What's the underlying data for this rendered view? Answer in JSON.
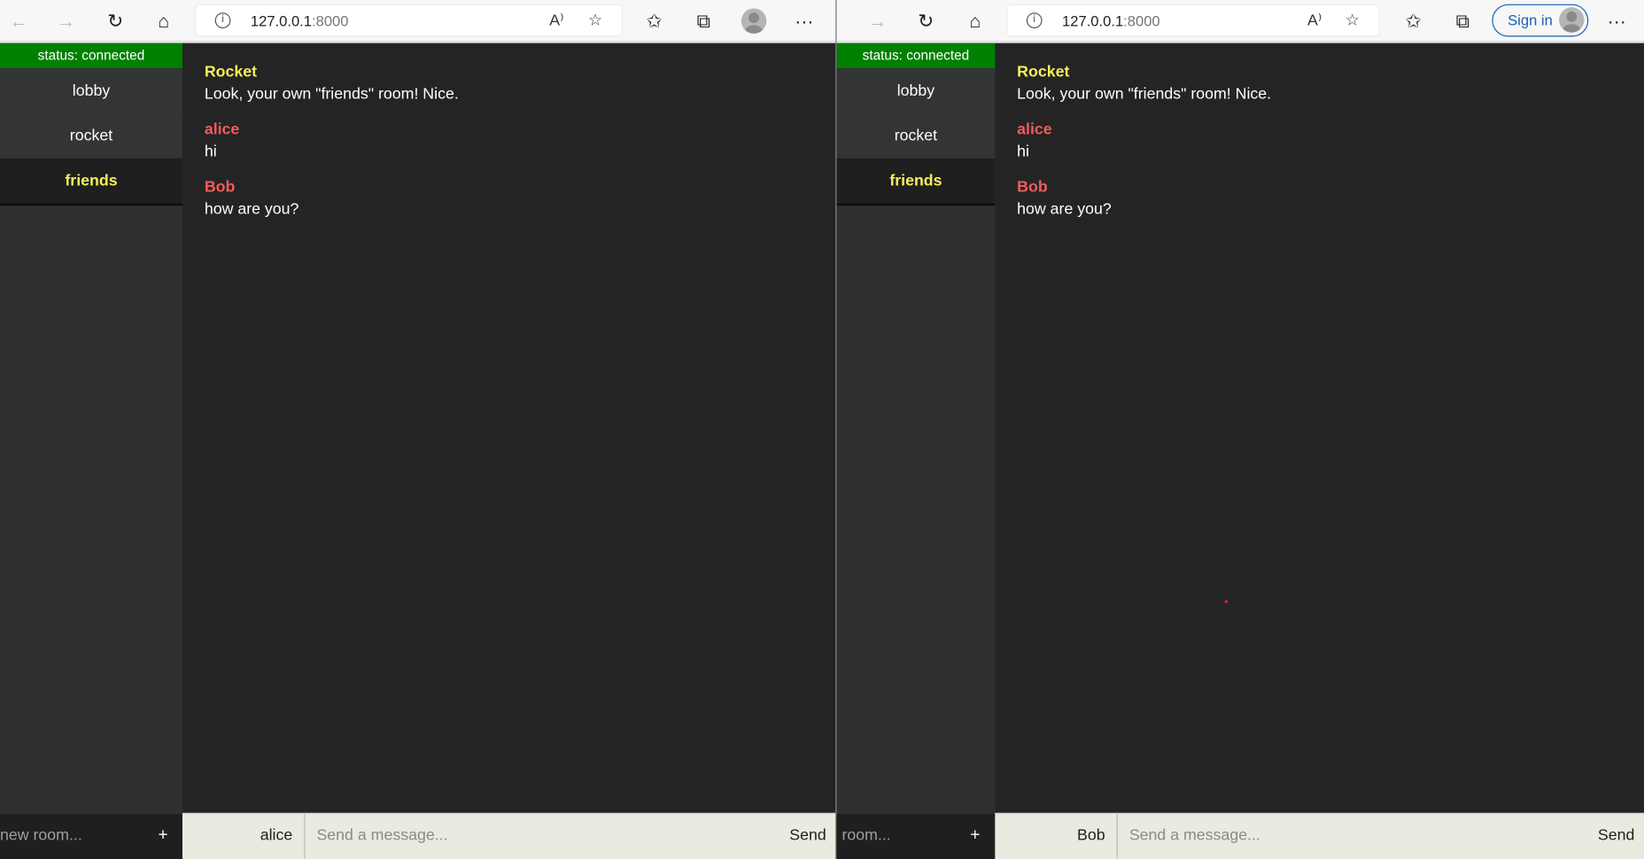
{
  "browser": {
    "url_host": "127.0.0.1",
    "url_port": ":8000",
    "sign_in": "Sign in",
    "more": "···",
    "icons": [
      "back-icon",
      "forward-icon",
      "refresh-icon",
      "home-icon",
      "info-icon",
      "read-aloud-icon",
      "add-favorite-icon",
      "favorites-icon",
      "collections-icon",
      "profile-icon",
      "more-icon"
    ]
  },
  "left_app": {
    "status": "status: connected",
    "rooms": [
      "lobby",
      "rocket",
      "friends"
    ],
    "active_room": "friends",
    "new_room_placeholder": "new room...",
    "add_button": "+",
    "username": "alice",
    "message_placeholder": "Send a message...",
    "send": "Send"
  },
  "right_app": {
    "status": "status: connected",
    "rooms": [
      "lobby",
      "rocket",
      "friends"
    ],
    "active_room": "friends",
    "new_room_placeholder": "room...",
    "add_button": "+",
    "username": "Bob",
    "message_placeholder": "Send a message...",
    "send": "Send"
  },
  "messages": [
    {
      "author": "Rocket",
      "text": "Look, your own \"friends\" room! Nice.",
      "color": "#f2ef5c"
    },
    {
      "author": "alice",
      "text": "hi",
      "color": "#f25c5c"
    },
    {
      "author": "Bob",
      "text": "how are you?",
      "color": "#f25c5c"
    }
  ],
  "colors": {
    "status_bg": "#008000",
    "active_room": "#f2ef5c",
    "app_bg": "#242424",
    "sidebar_bg": "#2f3030",
    "composer_bg": "#e9ebe0"
  }
}
